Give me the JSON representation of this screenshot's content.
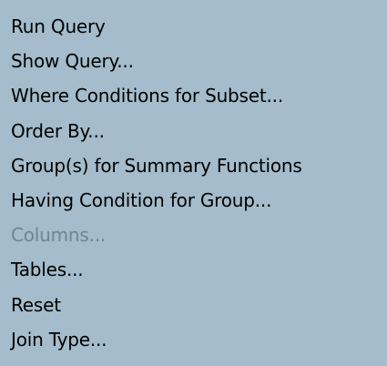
{
  "menu": {
    "items": [
      {
        "label": "Run Query",
        "enabled": true
      },
      {
        "label": "Show Query...",
        "enabled": true
      },
      {
        "label": "Where Conditions for Subset...",
        "enabled": true
      },
      {
        "label": "Order By...",
        "enabled": true
      },
      {
        "label": "Group(s) for Summary Functions",
        "enabled": true
      },
      {
        "label": "Having Condition for Group...",
        "enabled": true
      },
      {
        "label": "Columns...",
        "enabled": false
      },
      {
        "label": "Tables...",
        "enabled": true
      },
      {
        "label": "Reset",
        "enabled": true
      },
      {
        "label": "Join Type...",
        "enabled": true
      }
    ]
  },
  "colors": {
    "background": "#a4bccb",
    "text": "#000000",
    "disabled_text": "#6b8798"
  }
}
